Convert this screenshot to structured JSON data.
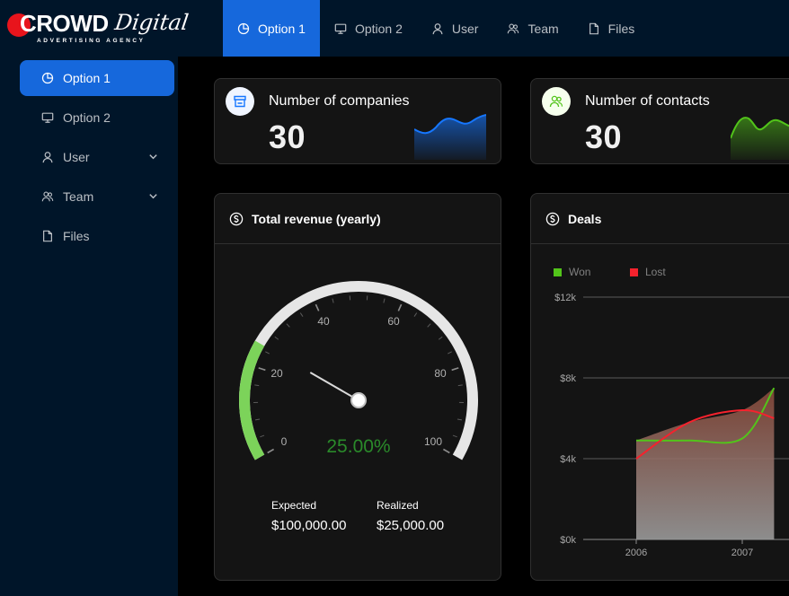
{
  "brand": {
    "name": "CROWD",
    "script": "Digital",
    "tagline": "ADVERTISING AGENCY"
  },
  "colors": {
    "primary": "#1668dc",
    "nav_bg": "#001529",
    "card_bg": "#141414",
    "won": "#52c41a",
    "lost": "#f5222d",
    "gauge_value": "#2a8a2a"
  },
  "top_nav": [
    {
      "label": "Option 1",
      "icon": "pie-chart-icon",
      "active": true
    },
    {
      "label": "Option 2",
      "icon": "desktop-icon",
      "active": false
    },
    {
      "label": "User",
      "icon": "user-icon",
      "active": false
    },
    {
      "label": "Team",
      "icon": "team-icon",
      "active": false
    },
    {
      "label": "Files",
      "icon": "file-icon",
      "active": false
    }
  ],
  "sidebar": [
    {
      "label": "Option 1",
      "icon": "pie-chart-icon",
      "active": true
    },
    {
      "label": "Option 2",
      "icon": "desktop-icon"
    },
    {
      "label": "User",
      "icon": "user-icon",
      "expandable": true
    },
    {
      "label": "Team",
      "icon": "team-icon",
      "expandable": true
    },
    {
      "label": "Files",
      "icon": "file-icon"
    }
  ],
  "stats": {
    "companies": {
      "title": "Number of companies",
      "value": "30",
      "icon": "shop-icon"
    },
    "contacts": {
      "title": "Number of contacts",
      "value": "30",
      "icon": "team-icon"
    }
  },
  "revenue": {
    "title": "Total revenue (yearly)",
    "gauge_percent": "25.00%",
    "gauge_fraction": 0.25,
    "ticks": [
      "0",
      "20",
      "40",
      "60",
      "80",
      "100"
    ],
    "expected_label": "Expected",
    "expected_value": "$100,000.00",
    "realized_label": "Realized",
    "realized_value": "$25,000.00"
  },
  "deals": {
    "title": "Deals",
    "legend": [
      "Won",
      "Lost"
    ],
    "y_ticks": [
      "$12k",
      "$8k",
      "$4k",
      "$0k"
    ],
    "x_ticks": [
      "2006",
      "2007"
    ]
  },
  "chart_data": {
    "type": "area",
    "title": "Deals",
    "x": [
      2006,
      2006.5,
      2007,
      2007.3
    ],
    "series": [
      {
        "name": "Won",
        "values": [
          4.9,
          4.9,
          5.0,
          7.5
        ]
      },
      {
        "name": "Lost",
        "values": [
          4.0,
          5.8,
          6.4,
          6.0
        ]
      }
    ],
    "ylim": [
      0,
      12
    ],
    "y_unit": "$k",
    "legend": "top-left",
    "grid": true
  }
}
